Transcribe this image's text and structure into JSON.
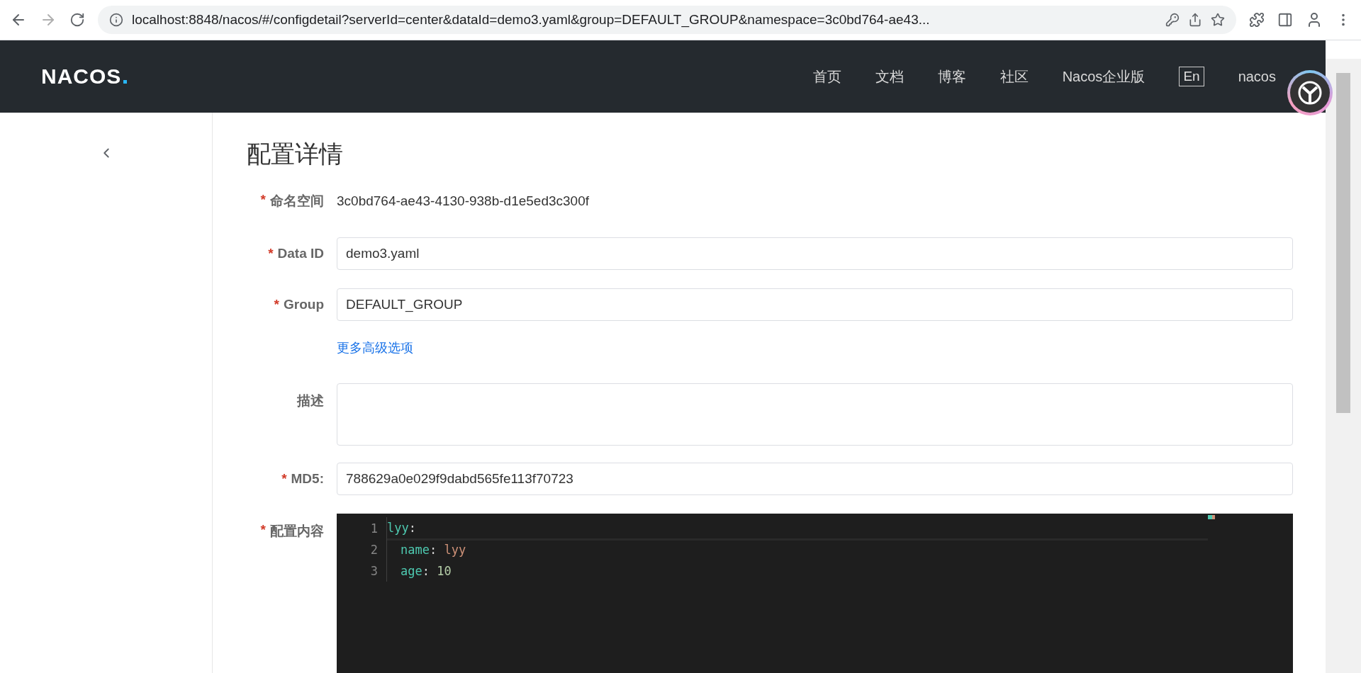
{
  "browser": {
    "url": "localhost:8848/nacos/#/configdetail?serverId=center&dataId=demo3.yaml&group=DEFAULT_GROUP&namespace=3c0bd764-ae43..."
  },
  "header": {
    "logo": "NACOS",
    "nav": [
      "首页",
      "文档",
      "博客",
      "社区",
      "Nacos企业版"
    ],
    "language": "En",
    "user": "nacos"
  },
  "page": {
    "title": "配置详情"
  },
  "form": [
    {
      "kind": "text",
      "mark": "*",
      "label": "命名空间",
      "value": "3c0bd764-ae43-4130-938b-d1e5ed3c300f"
    },
    {
      "kind": "input",
      "mark": "*",
      "label": "Data ID",
      "value": "demo3.yaml"
    },
    {
      "kind": "input",
      "mark": "*",
      "label": "Group",
      "value": "DEFAULT_GROUP"
    },
    {
      "kind": "link",
      "value": "更多高级选项"
    },
    {
      "kind": "textarea",
      "label": "描述"
    },
    {
      "kind": "input",
      "mark": "*",
      "label": "MD5:",
      "value": "788629a0e029f9dabd565fe113f70723"
    },
    {
      "kind": "editor",
      "mark": "*",
      "label": "配置内容"
    }
  ],
  "editor": {
    "lines": [
      {
        "number": "1",
        "indented": false,
        "tokens": [
          {
            "text": "lyy",
            "color": "#4ec9b0"
          },
          {
            "text": ":",
            "color": "#d4d4d4"
          }
        ]
      },
      {
        "number": "2",
        "indented": true,
        "tokens": [
          {
            "text": "name",
            "color": "#4ec9b0"
          },
          {
            "text": ": ",
            "color": "#d4d4d4"
          },
          {
            "text": "lyy",
            "color": "#ce9178"
          }
        ]
      },
      {
        "number": "3",
        "indented": true,
        "tokens": [
          {
            "text": "age",
            "color": "#4ec9b0"
          },
          {
            "text": ": ",
            "color": "#d4d4d4"
          },
          {
            "text": "10",
            "color": "#b5cea8"
          }
        ]
      }
    ]
  }
}
